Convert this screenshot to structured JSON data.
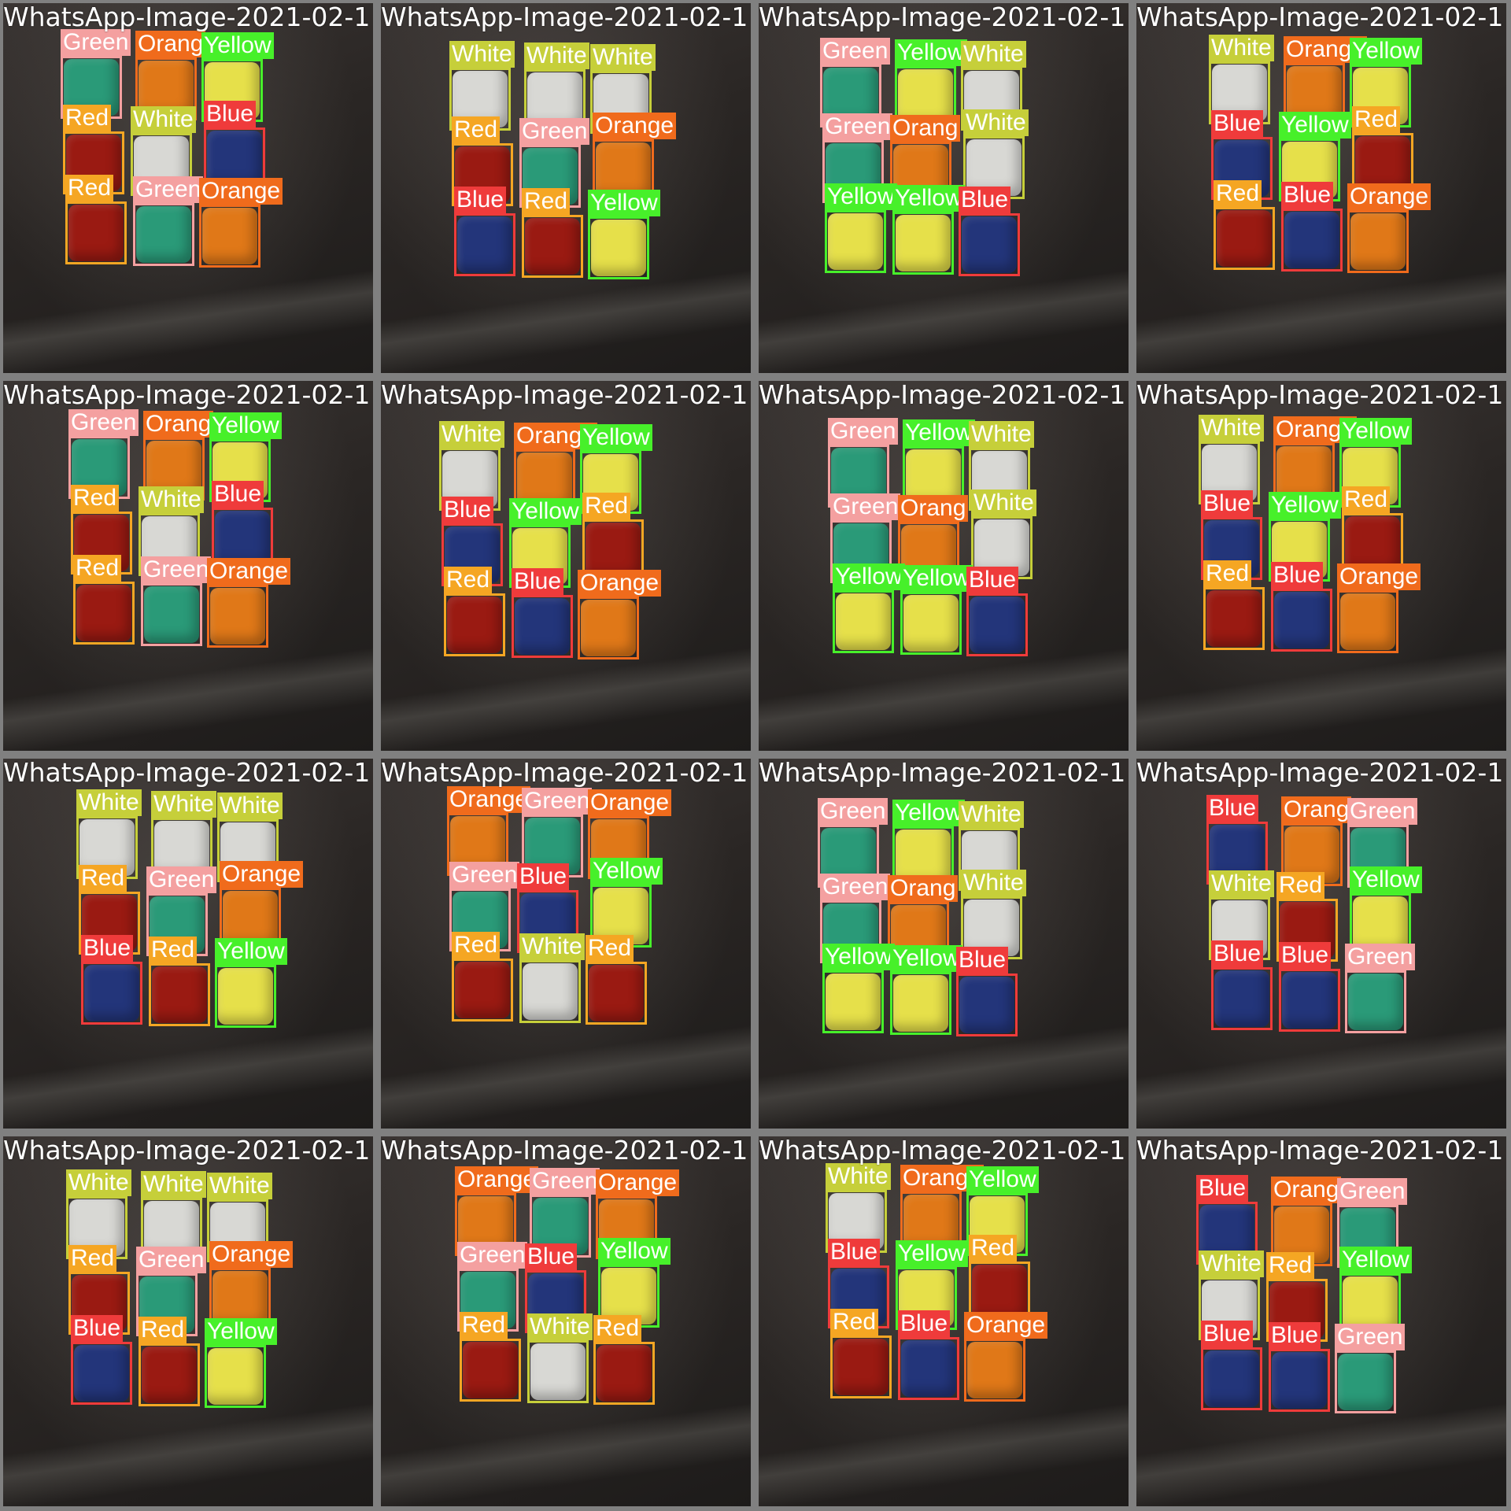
{
  "mosaic": {
    "class_colors": {
      "Green": {
        "box": "#f4a0a0",
        "label_bg": "#f4a0a0",
        "fill": "#2a9a78"
      },
      "Orange": {
        "box": "#f06b1c",
        "label_bg": "#f06b1c",
        "fill": "#e07818"
      },
      "Yellow": {
        "box": "#47f02a",
        "label_bg": "#47f02a",
        "fill": "#e6e04a"
      },
      "White": {
        "box": "#c6cf3a",
        "label_bg": "#c6cf3a",
        "fill": "#d8d8d4"
      },
      "Blue": {
        "box": "#ef3b3b",
        "label_bg": "#ef3b3b",
        "fill": "#23357a"
      },
      "Red": {
        "box": "#f5a623",
        "label_bg": "#f5a623",
        "fill": "#9a1a12"
      }
    },
    "tiles": [
      {
        "caption": "WhatsApp-Image-2021-02-1",
        "detections": [
          "Green",
          "Orang",
          "Yellow",
          "Red",
          "White",
          "Blue",
          "Red",
          "Green",
          "Orange"
        ]
      },
      {
        "caption": "WhatsApp-Image-2021-02-1",
        "detections": [
          "White",
          "White",
          "White",
          "Red",
          "Green",
          "Orange",
          "Blue",
          "Red",
          "Yellow"
        ]
      },
      {
        "caption": "WhatsApp-Image-2021-02-1",
        "detections": [
          "Green",
          "Yellow",
          "White",
          "Green",
          "Orang",
          "White",
          "Yellow",
          "Yellow",
          "Blue"
        ]
      },
      {
        "caption": "WhatsApp-Image-2021-02-1",
        "detections": [
          "White",
          "Orange",
          "Yellow",
          "Blue",
          "Yellow",
          "Red",
          "Red",
          "Blue",
          "Orange"
        ]
      },
      {
        "caption": "WhatsApp-Image-2021-02-1",
        "detections": [
          "Green",
          "Orang",
          "Yellow",
          "Red",
          "White",
          "Blue",
          "Red",
          "Green",
          "Orange"
        ]
      },
      {
        "caption": "WhatsApp-Image-2021-02-1",
        "detections": [
          "White",
          "Orange",
          "Yellow",
          "Blue",
          "Yellow",
          "Red",
          "Red",
          "Blue",
          "Orange"
        ]
      },
      {
        "caption": "WhatsApp-Image-2021-02-1",
        "detections": [
          "Green",
          "Yellow",
          "White",
          "Green",
          "Orang",
          "White",
          "Yellow",
          "Yellow",
          "Blue"
        ]
      },
      {
        "caption": "WhatsApp-Image-2021-02-1",
        "detections": [
          "White",
          "Orange",
          "Yellow",
          "Blue",
          "Yellow",
          "Red",
          "Red",
          "Blue",
          "Orange"
        ]
      },
      {
        "caption": "WhatsApp-Image-2021-02-1",
        "detections": [
          "White",
          "White",
          "White",
          "Red",
          "Green",
          "Orange",
          "Blue",
          "Red",
          "Yellow"
        ]
      },
      {
        "caption": "WhatsApp-Image-2021-02-1",
        "detections": [
          "Orange",
          "Green",
          "Orange",
          "Green",
          "Blue",
          "Yellow",
          "Red",
          "White",
          "Red"
        ]
      },
      {
        "caption": "WhatsApp-Image-2021-02-1",
        "detections": [
          "Green",
          "Yellow",
          "White",
          "Green",
          "Orang",
          "White",
          "Yellow",
          "Yellow",
          "Blue"
        ]
      },
      {
        "caption": "WhatsApp-Image-2021-02-1",
        "detections": [
          "Blue",
          "Orang",
          "Green",
          "White",
          "Red",
          "Yellow",
          "Blue",
          "Blue",
          "Green"
        ]
      },
      {
        "caption": "WhatsApp-Image-2021-02-1",
        "detections": [
          "White",
          "White",
          "White",
          "Red",
          "Green",
          "Orange",
          "Blue",
          "Red",
          "Yellow"
        ]
      },
      {
        "caption": "WhatsApp-Image-2021-02-1",
        "detections": [
          "Orange",
          "Green",
          "Orange",
          "Green",
          "Blue",
          "Yellow",
          "Red",
          "White",
          "Red"
        ]
      },
      {
        "caption": "WhatsApp-Image-2021-02-1",
        "detections": [
          "White",
          "Orange",
          "Yellow",
          "Blue",
          "Yellow",
          "Red",
          "Red",
          "Blue",
          "Orange"
        ]
      },
      {
        "caption": "WhatsApp-Image-2021-02-1",
        "detections": [
          "Blue",
          "Orang",
          "Green",
          "White",
          "Red",
          "Yellow",
          "Blue",
          "Blue",
          "Green"
        ]
      }
    ]
  }
}
